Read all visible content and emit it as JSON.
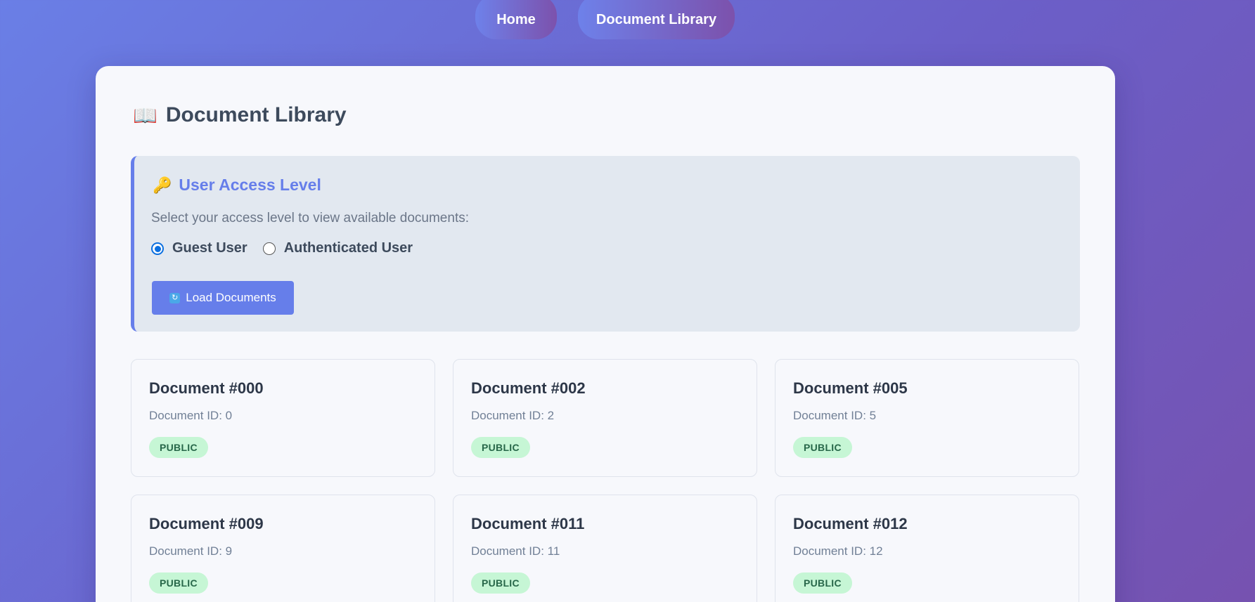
{
  "nav": {
    "home": "Home",
    "library": "Document Library"
  },
  "page": {
    "title": "Document Library",
    "title_icon": "📖"
  },
  "access": {
    "icon": "🔑",
    "heading": "User Access Level",
    "description": "Select your access level to view available documents:",
    "options": [
      {
        "label": "Guest User",
        "checked": true
      },
      {
        "label": "Authenticated User",
        "checked": false
      }
    ],
    "load_button": "Load Documents",
    "load_icon": "🔄"
  },
  "documents": [
    {
      "title": "Document #000",
      "id_text": "Document ID: 0",
      "badge": "PUBLIC"
    },
    {
      "title": "Document #002",
      "id_text": "Document ID: 2",
      "badge": "PUBLIC"
    },
    {
      "title": "Document #005",
      "id_text": "Document ID: 5",
      "badge": "PUBLIC"
    },
    {
      "title": "Document #009",
      "id_text": "Document ID: 9",
      "badge": "PUBLIC"
    },
    {
      "title": "Document #011",
      "id_text": "Document ID: 11",
      "badge": "PUBLIC"
    },
    {
      "title": "Document #012",
      "id_text": "Document ID: 12",
      "badge": "PUBLIC"
    }
  ],
  "colors": {
    "accent": "#667eea",
    "badge_bg": "#c6f6d5",
    "badge_text": "#276749"
  }
}
